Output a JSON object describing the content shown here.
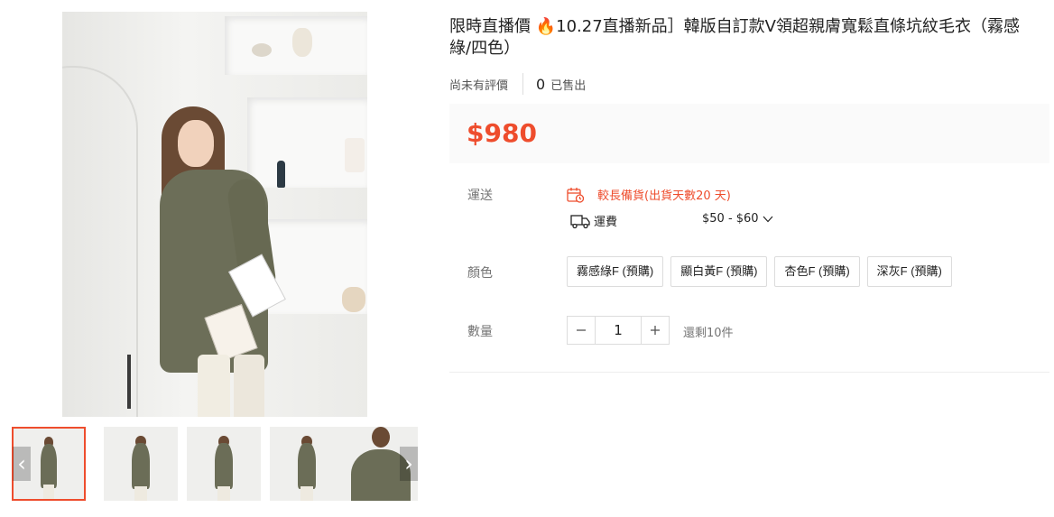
{
  "product": {
    "title_prefix": "限時直播價 ",
    "title_fire": "🔥",
    "title_rest": "10.27直播新品］韓版自訂款V領超親膚寬鬆直條坑紋毛衣（霧感綠/四色）",
    "rating_text": "尚未有評價",
    "sold_count": "0",
    "sold_label": "已售出",
    "price": "$980"
  },
  "gallery": {
    "thumbnail_count": 5,
    "active_index": 0,
    "prev_icon": "chevron-left-icon",
    "next_icon": "chevron-right-icon"
  },
  "shipping": {
    "label": "運送",
    "warning": "較長備貨(出貨天數20 天)",
    "warning_icon": "calendar-clock-icon",
    "fee_icon": "truck-icon",
    "fee_label": "運費",
    "fee_range": "$50 - $60"
  },
  "colors": {
    "label": "顏色",
    "options": [
      "霧感綠F (預購)",
      "顯白黃F (預購)",
      "杏色F (預購)",
      "深灰F (預購)"
    ]
  },
  "quantity": {
    "label": "數量",
    "value": "1",
    "stock": "還剩10件"
  },
  "theme": {
    "accent": "#ee4d2d",
    "price_bg": "#fafafa"
  }
}
